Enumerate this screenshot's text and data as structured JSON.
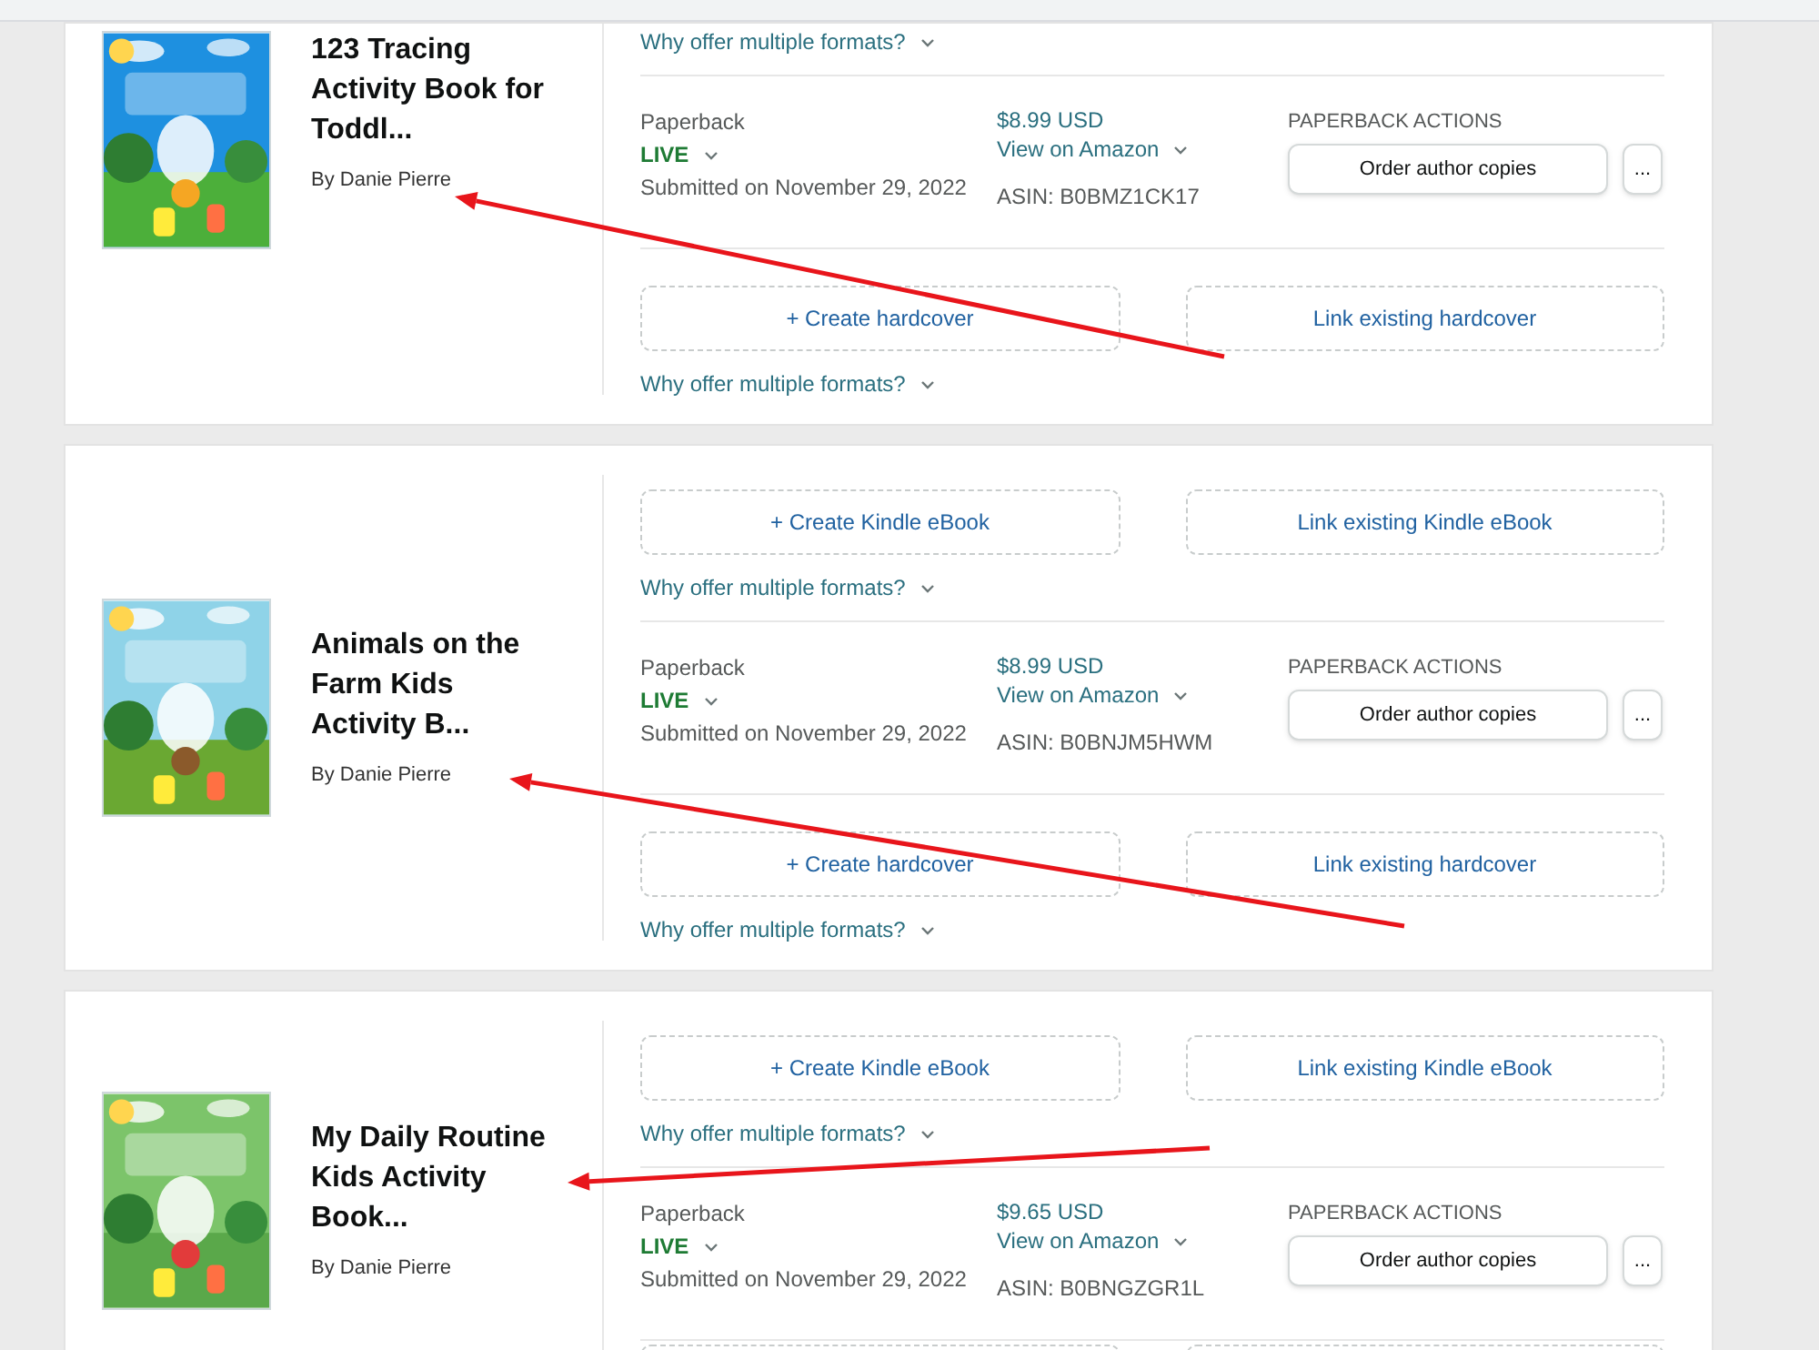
{
  "books": [
    {
      "title": "123 Tracing Activity Book for Toddl...",
      "author": "By Danie Pierre",
      "sections": [
        {
          "kind": "why",
          "link": "Why offer multiple formats?"
        },
        {
          "kind": "paperback",
          "format": "Paperback",
          "status": "LIVE",
          "submitted": "Submitted on November 29, 2022",
          "price": "$8.99 USD",
          "view": "View on Amazon",
          "asin": "ASIN: B0BMZ1CK17",
          "actions_label": "PAPERBACK ACTIONS",
          "order": "Order author copies",
          "more": "..."
        },
        {
          "kind": "buttons",
          "buttons": [
            "+ Create hardcover",
            "Link existing hardcover"
          ],
          "link": "Why offer multiple formats?"
        }
      ]
    },
    {
      "title": "Animals on the Farm Kids Activity B...",
      "author": "By Danie Pierre",
      "sections": [
        {
          "kind": "buttons",
          "buttons": [
            "+ Create Kindle eBook",
            "Link existing Kindle eBook"
          ],
          "link": "Why offer multiple formats?"
        },
        {
          "kind": "paperback",
          "format": "Paperback",
          "status": "LIVE",
          "submitted": "Submitted on November 29, 2022",
          "price": "$8.99 USD",
          "view": "View on Amazon",
          "asin": "ASIN: B0BNJM5HWM",
          "actions_label": "PAPERBACK ACTIONS",
          "order": "Order author copies",
          "more": "..."
        },
        {
          "kind": "buttons",
          "buttons": [
            "+ Create hardcover",
            "Link existing hardcover"
          ],
          "link": "Why offer multiple formats?"
        }
      ]
    },
    {
      "title": "My Daily Routine Kids Activity Book...",
      "author": "By Danie Pierre",
      "sections": [
        {
          "kind": "buttons",
          "buttons": [
            "+ Create Kindle eBook",
            "Link existing Kindle eBook"
          ],
          "link": "Why offer multiple formats?"
        },
        {
          "kind": "paperback",
          "format": "Paperback",
          "status": "LIVE",
          "submitted": "Submitted on November 29, 2022",
          "price": "$9.65 USD",
          "view": "View on Amazon",
          "asin": "ASIN: B0BNGZGR1L",
          "actions_label": "PAPERBACK ACTIONS",
          "order": "Order author copies",
          "more": "..."
        },
        {
          "kind": "cut_buttons"
        }
      ]
    }
  ]
}
